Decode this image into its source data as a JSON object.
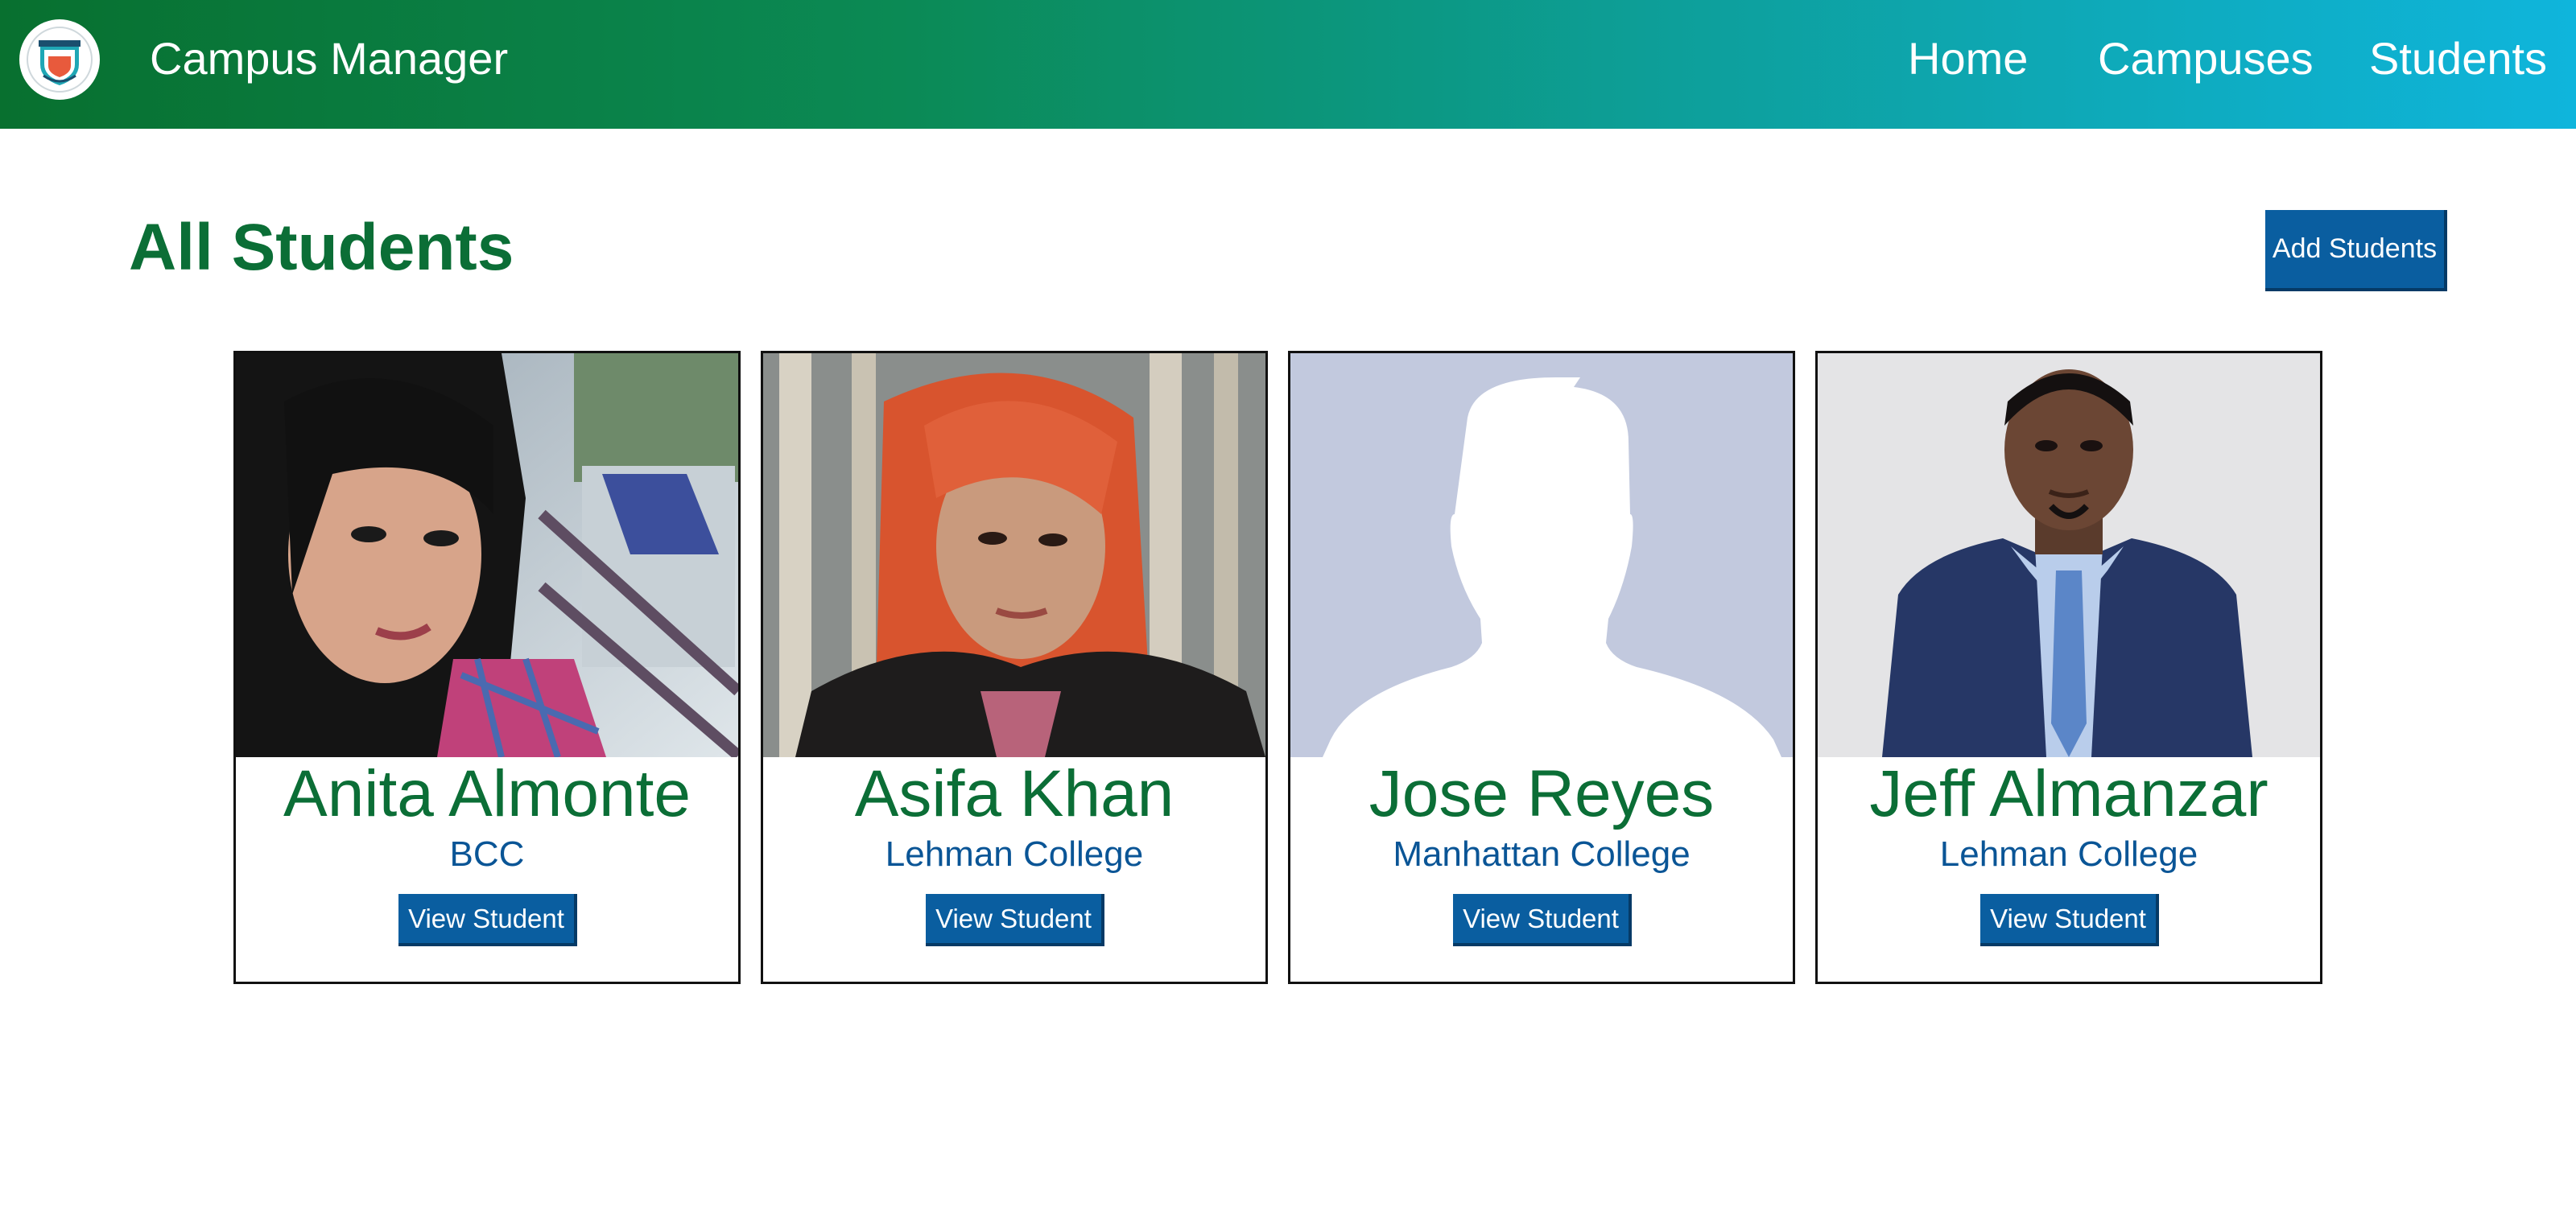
{
  "navbar": {
    "logo_icon": "university-crest-icon",
    "brand": "Campus Manager",
    "links": {
      "home": "Home",
      "campuses": "Campuses",
      "students": "Students"
    },
    "gradient_start": "#08702f",
    "gradient_end": "#0fb5dc"
  },
  "page": {
    "title": "All Students",
    "add_button_label": "Add Students"
  },
  "colors": {
    "heading_green": "#0b6e36",
    "button_blue": "#0a5ea0",
    "campus_blue": "#0a5596"
  },
  "students": [
    {
      "name": "Anita Almonte",
      "campus": "BCC",
      "view_label": "View Student",
      "photo_alt": "Anita Almonte"
    },
    {
      "name": "Asifa Khan",
      "campus": "Lehman College",
      "view_label": "View Student",
      "photo_alt": "Asifa Khan"
    },
    {
      "name": "Jose Reyes",
      "campus": "Manhattan College",
      "view_label": "View Student",
      "photo_alt": "Jose Reyes"
    },
    {
      "name": "Jeff Almanzar",
      "campus": "Lehman College",
      "view_label": "View Student",
      "photo_alt": "Jeff Almanzar"
    }
  ]
}
